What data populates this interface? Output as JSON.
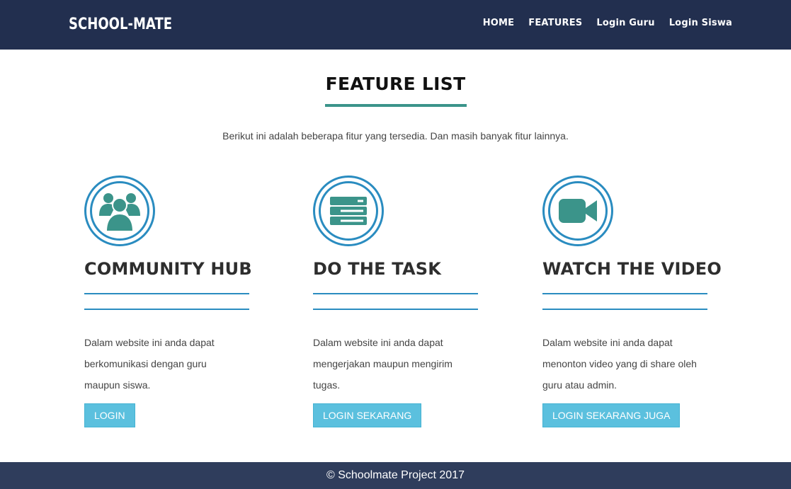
{
  "navbar": {
    "brand": "SCHOOL-MATE",
    "links": [
      {
        "label": "HOME"
      },
      {
        "label": "FEATURES"
      },
      {
        "label": "Login Guru"
      },
      {
        "label": "Login Siswa"
      }
    ]
  },
  "section": {
    "title": "FEATURE LIST",
    "subtitle": "Berikut ini adalah beberapa fitur yang tersedia. Dan masih banyak fitur lainnya."
  },
  "features": [
    {
      "icon": "users-group-icon",
      "title": "COMMUNITY HUB",
      "description": "Dalam website ini anda dapat berkomunikasi dengan guru maupun siswa.",
      "button": "LOGIN"
    },
    {
      "icon": "server-list-icon",
      "title": "DO THE TASK",
      "description": "Dalam website ini anda dapat mengerjakan maupun mengirim tugas.",
      "button": "LOGIN SEKARANG"
    },
    {
      "icon": "video-camera-icon",
      "title": "WATCH THE VIDEO",
      "description": "Dalam website ini anda dapat menonton video yang di share oleh guru atau admin.",
      "button": "LOGIN SEKARANG JUGA"
    }
  ],
  "footer": {
    "text": "© Schoolmate Project 2017"
  },
  "colors": {
    "navbar_bg": "#222f4f",
    "footer_bg": "#2f3d5c",
    "accent_teal": "#3b948a",
    "accent_blue": "#2a8cc0",
    "button_bg": "#5bc0de"
  }
}
